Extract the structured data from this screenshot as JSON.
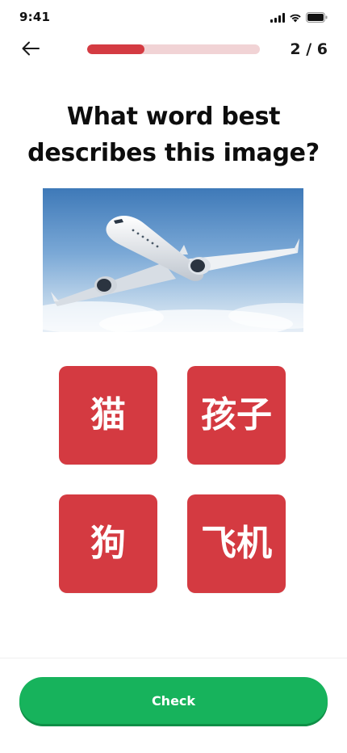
{
  "status_bar": {
    "time": "9:41",
    "icons": [
      "signal-icon",
      "wifi-icon",
      "battery-icon"
    ]
  },
  "header": {
    "back_icon": "arrow-left-icon",
    "progress": 0.333,
    "progress_color": "#d43b42",
    "step_counter": "2 / 6"
  },
  "question": {
    "line1": "What word best",
    "line2": "describes this image?"
  },
  "image": {
    "subject": "airplane-image"
  },
  "options": [
    {
      "label": "猫"
    },
    {
      "label": "孩子"
    },
    {
      "label": "狗"
    },
    {
      "label": "飞机"
    }
  ],
  "footer": {
    "check_label": "Check",
    "check_color": "#17b35c"
  },
  "colors": {
    "option_bg": "#d43a41",
    "accent_red": "#d43b42",
    "accent_green": "#17b35c"
  }
}
